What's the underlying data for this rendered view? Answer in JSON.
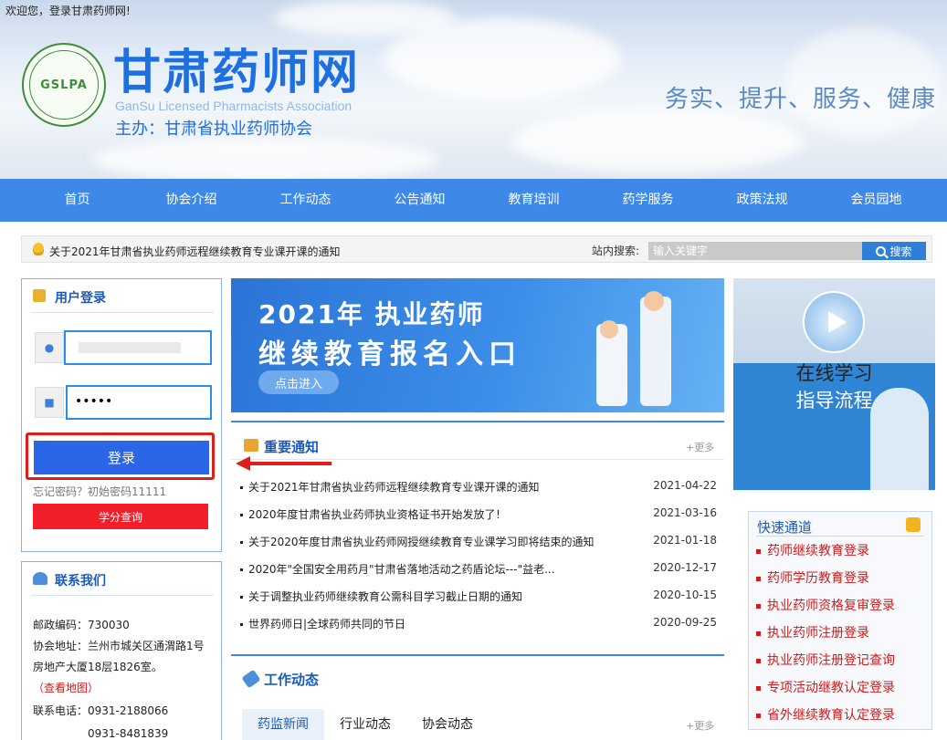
{
  "welcome": "欢迎您，登录甘肃药师网!",
  "logo": {
    "mark": "GSLPA"
  },
  "site": {
    "title": "甘肃药师网",
    "subtitle": "GanSu Licensed Pharmacists Association",
    "host": "主办：甘肃省执业药师协会",
    "slogan": "务实、提升、服务、健康"
  },
  "nav": {
    "items": [
      "首页",
      "协会介绍",
      "工作动态",
      "公告通知",
      "教育培训",
      "药学服务",
      "政策法规",
      "会员园地"
    ]
  },
  "notice_bar": {
    "text": "关于2021年甘肃省执业药师远程继续教育专业课开课的通知",
    "search_label": "站内搜索:",
    "search_placeholder": "输入关键字",
    "search_button": "搜索"
  },
  "login": {
    "title": "用户登录",
    "username_value": "",
    "password_value": "•••••",
    "login_button": "登录",
    "forgot": "忘记密码？初始密码11111",
    "credit_button": "学分查询"
  },
  "contact": {
    "title": "联系我们",
    "lines": [
      "邮政编码：730030",
      "协会地址：兰州市城关区通渭路1号",
      "房地产大厦18层1826室。",
      "（查看地图）",
      "联系电话：0931-2188066",
      "　　　　　0931-8481839"
    ]
  },
  "banner": {
    "line1": "2021年 执业药师",
    "line2": "继续教育报名入口",
    "button": "点击进入"
  },
  "news": {
    "title": "重要通知",
    "more": "+更多",
    "rows": [
      {
        "text": "关于2021年甘肃省执业药师远程继续教育专业课开课的通知",
        "date": "2021-04-22"
      },
      {
        "text": "2020年度甘肃省执业药师执业资格证书开始发放了！",
        "date": "2021-03-16"
      },
      {
        "text": "关于2020年度甘肃省执业药师网授继续教育专业课学习即将结束的通知",
        "date": "2021-01-18"
      },
      {
        "text": "2020年\"全国安全用药月\"甘肃省落地活动之药盾论坛---\"益老...",
        "date": "2020-12-17"
      },
      {
        "text": "关于调整执业药师继续教育公需科目学习截止日期的通知",
        "date": "2020-10-15"
      },
      {
        "text": "世界药师日|全球药师共同的节日",
        "date": "2020-09-25"
      }
    ]
  },
  "work": {
    "title": "工作动态",
    "tabs": [
      "药监新闻",
      "行业动态",
      "协会动态"
    ],
    "more": "+更多"
  },
  "side_video": {
    "line1": "在线学习",
    "line2": "指导流程"
  },
  "quick": {
    "title": "快速通道",
    "items": [
      "药师继续教育登录",
      "药师学历教育登录",
      "执业药师资格复审登录",
      "执业药师注册登录",
      "执业药师注册登记查询",
      "专项活动继教认定登录",
      "省外继续教育认定登录"
    ]
  },
  "colors": {
    "nav": "#3e89e8",
    "brand": "#1e6fe0",
    "highlight": "#e21c1c",
    "credit": "#f21f2b",
    "quick_red": "#d01b1b"
  }
}
